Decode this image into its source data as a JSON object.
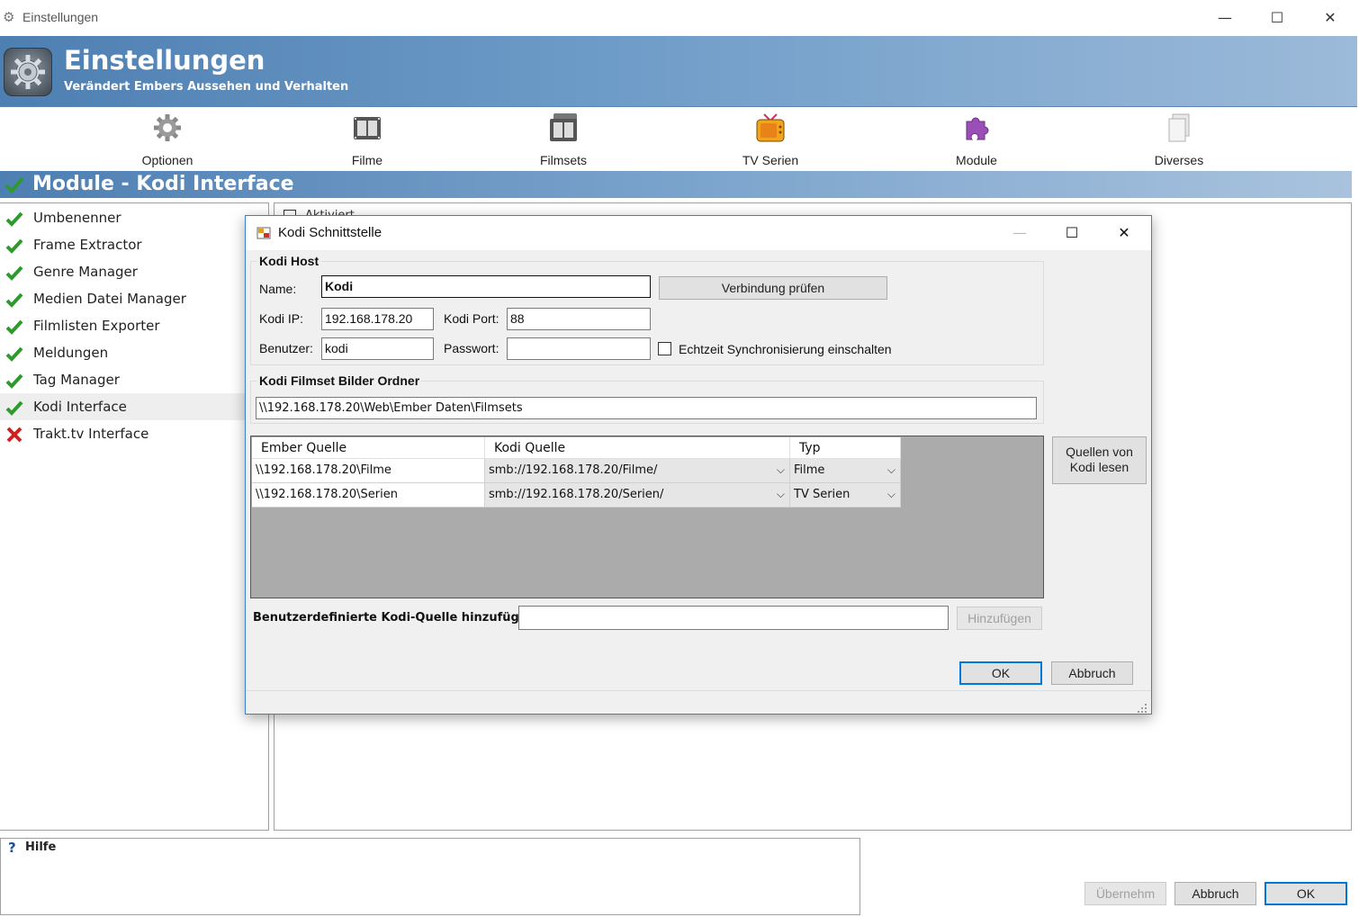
{
  "window": {
    "title": "Einstellungen"
  },
  "header": {
    "title": "Einstellungen",
    "subtitle": "Verändert Embers Aussehen und Verhalten"
  },
  "toolbar": {
    "items": [
      {
        "label": "Optionen",
        "icon": "gear-icon"
      },
      {
        "label": "Filme",
        "icon": "film-icon"
      },
      {
        "label": "Filmsets",
        "icon": "filmset-icon"
      },
      {
        "label": "TV Serien",
        "icon": "tv-icon"
      },
      {
        "label": "Module",
        "icon": "puzzle-icon"
      },
      {
        "label": "Diverses",
        "icon": "documents-icon"
      }
    ]
  },
  "section": {
    "title": "Module - Kodi Interface"
  },
  "modules": [
    {
      "label": "Umbenenner",
      "status": "enabled"
    },
    {
      "label": "Frame Extractor",
      "status": "enabled"
    },
    {
      "label": "Genre Manager",
      "status": "enabled"
    },
    {
      "label": "Medien Datei Manager",
      "status": "enabled"
    },
    {
      "label": "Filmlisten Exporter",
      "status": "enabled"
    },
    {
      "label": "Meldungen",
      "status": "enabled"
    },
    {
      "label": "Tag Manager",
      "status": "enabled"
    },
    {
      "label": "Kodi Interface",
      "status": "enabled"
    },
    {
      "label": "Trakt.tv Interface",
      "status": "disabled"
    }
  ],
  "right_panel": {
    "aktiviert_label": "Aktiviert"
  },
  "help": {
    "title": "Hilfe"
  },
  "footer": {
    "apply_label": "Übernehm",
    "cancel_label": "Abbruch",
    "ok_label": "OK"
  },
  "dialog": {
    "title": "Kodi Schnittstelle",
    "host_group": "Kodi Host",
    "name_label": "Name:",
    "name_value": "Kodi",
    "verify_button": "Verbindung prüfen",
    "ip_label": "Kodi IP:",
    "ip_value": "192.168.178.20",
    "port_label": "Kodi Port:",
    "port_value": "88",
    "user_label": "Benutzer:",
    "user_value": "kodi",
    "password_label": "Passwort:",
    "password_value": "",
    "realtime_sync_label": "Echtzeit Synchronisierung einschalten",
    "filmset_group": "Kodi Filmset Bilder Ordner",
    "filmset_path": "\\\\192.168.178.20\\Web\\Ember Daten\\Filmsets",
    "grid_headers": [
      "Ember Quelle",
      "Kodi Quelle",
      "Typ"
    ],
    "grid_rows": [
      {
        "ember": "\\\\192.168.178.20\\Filme",
        "kodi": "smb://192.168.178.20/Filme/",
        "typ": "Filme"
      },
      {
        "ember": "\\\\192.168.178.20\\Serien",
        "kodi": "smb://192.168.178.20/Serien/",
        "typ": "TV Serien"
      }
    ],
    "read_sources_button": "Quellen von Kodi lesen",
    "custom_source_label": "Benutzerdefinierte Kodi-Quelle hinzufügen:",
    "custom_source_value": "",
    "add_button": "Hinzufügen",
    "ok_button": "OK",
    "cancel_button": "Abbruch"
  },
  "colors": {
    "header_blue": "#4e7fb2",
    "check_green": "#2e9a2e",
    "error_red": "#d02020",
    "focus_blue": "#0078d7"
  }
}
